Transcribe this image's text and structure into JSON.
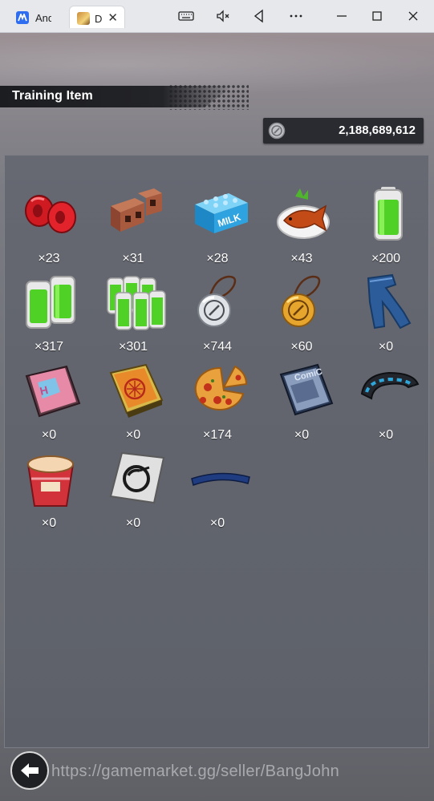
{
  "window": {
    "tabs": [
      {
        "label": "Andr"
      },
      {
        "label": "D"
      }
    ],
    "close_glyph": "✕"
  },
  "screen": {
    "title": "Training Item",
    "currency": {
      "icon": "coin-icon",
      "value": "2,188,689,612"
    }
  },
  "items": [
    {
      "icon": "red-dumbbell-weights-icon",
      "qty": "×23"
    },
    {
      "icon": "cinder-blocks-icon",
      "qty": "×31"
    },
    {
      "icon": "milk-carton-icon",
      "qty": "×28"
    },
    {
      "icon": "grilled-fish-plate-icon",
      "qty": "×43"
    },
    {
      "icon": "single-battery-icon",
      "qty": "×200"
    },
    {
      "icon": "double-battery-icon",
      "qty": "×317"
    },
    {
      "icon": "battery-pack-icon",
      "qty": "×301"
    },
    {
      "icon": "silver-medallion-icon",
      "qty": "×744"
    },
    {
      "icon": "gold-medallion-icon",
      "qty": "×60"
    },
    {
      "icon": "jeans-icon",
      "qty": "×0"
    },
    {
      "icon": "picture-book-icon",
      "qty": "×0"
    },
    {
      "icon": "orange-book-icon",
      "qty": "×0"
    },
    {
      "icon": "pizza-icon",
      "qty": "×174"
    },
    {
      "icon": "comic-book-icon",
      "qty": "×0"
    },
    {
      "icon": "wristband-icon",
      "qty": "×0"
    },
    {
      "icon": "cup-noodle-icon",
      "qty": "×0"
    },
    {
      "icon": "symbol-card-icon",
      "qty": "×0"
    },
    {
      "icon": "blue-headband-icon",
      "qty": "×0"
    }
  ],
  "watermark": "https://gamemarket.gg/seller/BangJohn",
  "colors": {
    "panel": "#5f626b",
    "header_bar": "#1c1d21",
    "battery_green": "#4fd126"
  }
}
